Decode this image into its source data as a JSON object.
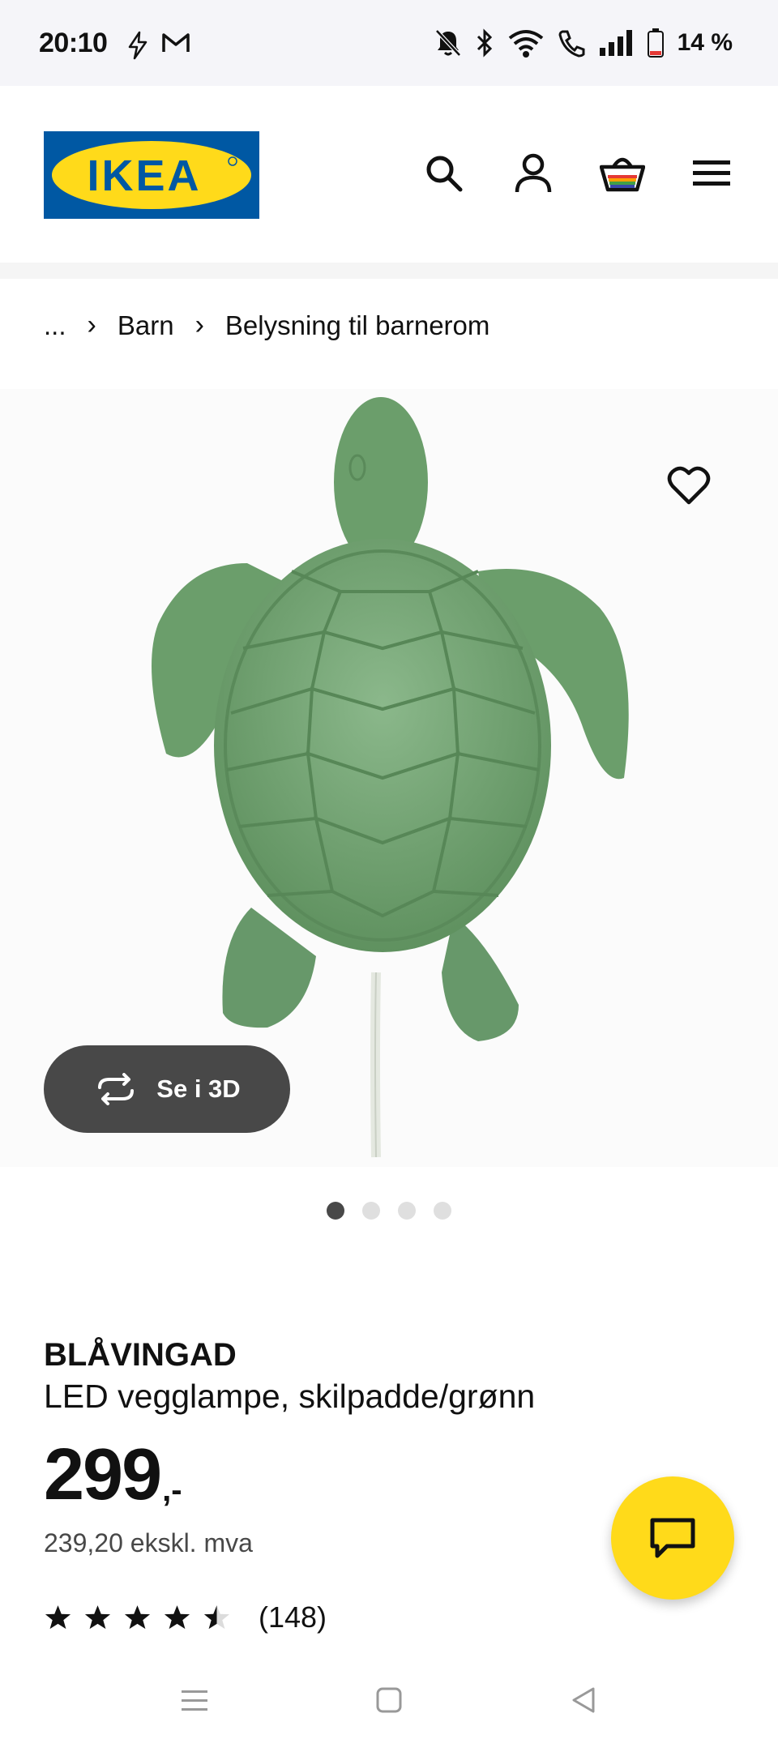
{
  "status_bar": {
    "time": "20:10",
    "battery_text": "14 %",
    "icons": [
      "lightning-icon",
      "gmail-icon",
      "mute-icon",
      "bluetooth-icon",
      "wifi-icon",
      "call-icon",
      "signal-icon",
      "battery-icon"
    ]
  },
  "header": {
    "logo_text": "IKEA",
    "icons": [
      "search-icon",
      "account-icon",
      "cart-icon",
      "menu-icon"
    ]
  },
  "breadcrumb": {
    "ellipsis": "...",
    "items": [
      "Barn",
      "Belysning til barnerom"
    ]
  },
  "gallery": {
    "view_3d_label": "Se i 3D",
    "dot_count": 4,
    "active_dot": 1
  },
  "product": {
    "name": "BLÅVINGAD",
    "description": "LED vegglampe, skilpadde/grønn",
    "price_main": "299",
    "price_suffix": ",-",
    "price_excl_vat": "239,20 ekskl. mva",
    "rating": 4.5,
    "rating_max": 5,
    "review_count": "(148)"
  },
  "colors": {
    "ikea_blue": "#0058a3",
    "ikea_yellow": "#ffda1a",
    "turtle_green": "#6b9e6b",
    "dark_button": "#484848"
  }
}
